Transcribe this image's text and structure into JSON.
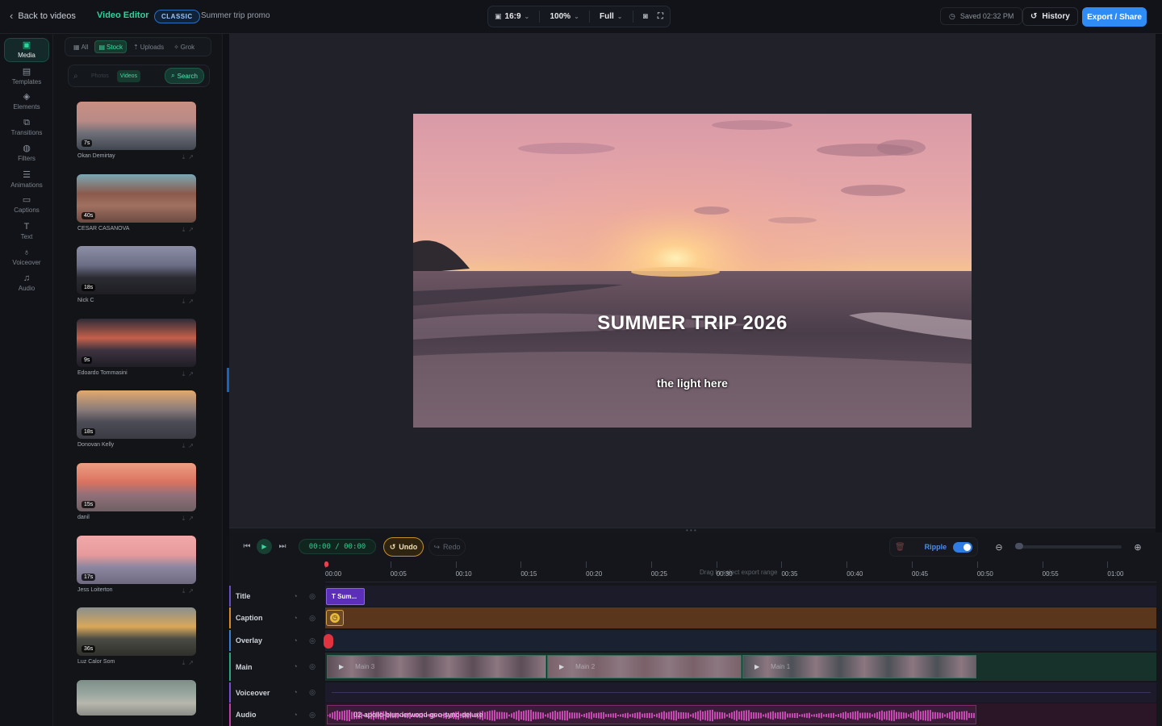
{
  "topbar": {
    "back_label": "Back to videos",
    "app_name": "Video Editor",
    "mode_badge": "CLASSIC",
    "project_name": "Summer trip promo",
    "aspect": "16:9",
    "zoom": "100%",
    "quality": "Full",
    "saved_status": "Saved 02:32 PM",
    "history_label": "History",
    "export_label": "Export / Share"
  },
  "rail": [
    {
      "label": "Media",
      "icon": "media-icon",
      "active": true
    },
    {
      "label": "Templates",
      "icon": "templates-icon"
    },
    {
      "label": "Elements",
      "icon": "elements-icon"
    },
    {
      "label": "Transitions",
      "icon": "transitions-icon"
    },
    {
      "label": "Filters",
      "icon": "filters-icon"
    },
    {
      "label": "Animations",
      "icon": "animations-icon"
    },
    {
      "label": "Captions",
      "icon": "captions-icon"
    },
    {
      "label": "Text",
      "icon": "text-icon"
    },
    {
      "label": "Voiceover",
      "icon": "microphone-icon"
    },
    {
      "label": "Audio",
      "icon": "music-icon"
    }
  ],
  "media": {
    "tabs": [
      {
        "label": "All"
      },
      {
        "label": "Stock",
        "active": true
      },
      {
        "label": "Uploads"
      },
      {
        "label": "Grok"
      }
    ],
    "filter_photos": "Photos",
    "filter_videos": "Videos",
    "search_label": "Search",
    "items": [
      {
        "duration": "7s",
        "author": "Okan Demirtay",
        "palette": [
          "#c98f83",
          "#b98a86",
          "#6f6f78",
          "#3f464f"
        ]
      },
      {
        "duration": "40s",
        "author": "CESAR CASANOVA",
        "palette": [
          "#7aa7b4",
          "#8b5a4c",
          "#a07060",
          "#6b4a42"
        ]
      },
      {
        "duration": "18s",
        "author": "Nick C",
        "palette": [
          "#8d8fa6",
          "#6b6d86",
          "#2b2c33",
          "#1d1d22"
        ]
      },
      {
        "duration": "9s",
        "author": "Edoardo Tommasini",
        "palette": [
          "#2c2b38",
          "#c5604b",
          "#3e3340",
          "#1f1d25"
        ]
      },
      {
        "duration": "18s",
        "author": "Donovan Kelly",
        "palette": [
          "#e3a96d",
          "#8a7b7a",
          "#4c4c56",
          "#3a3b43"
        ]
      },
      {
        "duration": "15s",
        "author": "danil",
        "palette": [
          "#ee9e84",
          "#d9725f",
          "#93707a",
          "#6e6063"
        ]
      },
      {
        "duration": "17s",
        "author": "Jess Loiterton",
        "palette": [
          "#f1a8a9",
          "#e79a9b",
          "#8c86a0",
          "#6f6a80"
        ]
      },
      {
        "duration": "36s",
        "author": "Luz Calor Som",
        "palette": [
          "#8a8f8e",
          "#d9a85a",
          "#4b4b45",
          "#2f2f2b"
        ]
      },
      {
        "duration": "",
        "author": "",
        "palette": [
          "#7d8f88",
          "#9aa7a1",
          "#b7b7ad",
          "#8a8c86"
        ]
      }
    ]
  },
  "preview": {
    "title_overlay": "SUMMER TRIP 2026",
    "caption_overlay": "the light here"
  },
  "timeline": {
    "timecode": "00:00 / 00:00",
    "undo_label": "Undo",
    "redo_label": "Redo",
    "ripple_label": "Ripple",
    "ripple_on": true,
    "ruler_hint": "Drag to select export range",
    "ticks": [
      "00:00",
      "00:05",
      "00:10",
      "00:15",
      "00:20",
      "00:25",
      "00:30",
      "00:35",
      "00:40",
      "00:45",
      "00:50",
      "00:55",
      "01:00"
    ],
    "tracks": [
      {
        "name": "Title",
        "color": "#6a4cc4"
      },
      {
        "name": "Caption",
        "color": "#d98a2b"
      },
      {
        "name": "Overlay",
        "color": "#3b7fd1"
      },
      {
        "name": "Main",
        "color": "#2fa57e"
      },
      {
        "name": "Voiceover",
        "color": "#7a4fd6"
      },
      {
        "name": "Audio",
        "color": "#c33fa8"
      }
    ],
    "title_clip": "T Sum...",
    "main_clips": [
      "Main 3",
      "Main 2",
      "Main 1"
    ],
    "audio_clip": "02-apollo-blunderwood-geo-sync-deluxe"
  }
}
